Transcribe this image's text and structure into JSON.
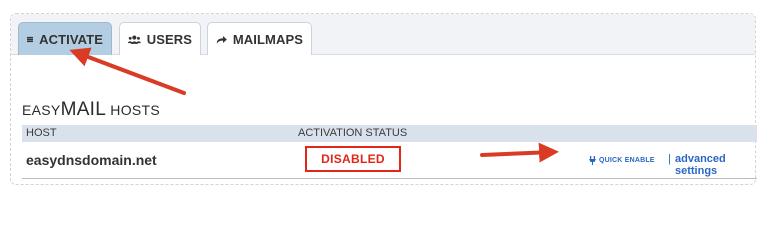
{
  "tabs": [
    {
      "label": "ACTIVATE",
      "icon": "server-icon",
      "active": true
    },
    {
      "label": "USERS",
      "icon": "users-icon",
      "active": false
    },
    {
      "label": "MAILMAPS",
      "icon": "share-arrow-icon",
      "active": false
    }
  ],
  "section": {
    "title_prefix": "EASY",
    "title_mid": "MAIL",
    "title_suffix": " HOSTS"
  },
  "table": {
    "headers": {
      "host": "HOST",
      "status": "ACTIVATION STATUS"
    },
    "rows": [
      {
        "host": "easydnsdomain.net",
        "status": "DISABLED",
        "quick_enable": "QUICK ENABLE",
        "separator": "|",
        "advanced": "advanced settings"
      }
    ]
  },
  "colors": {
    "accent": "#2a67c3",
    "alert_red": "#e2261a",
    "active_tab": "#b3cde3"
  }
}
